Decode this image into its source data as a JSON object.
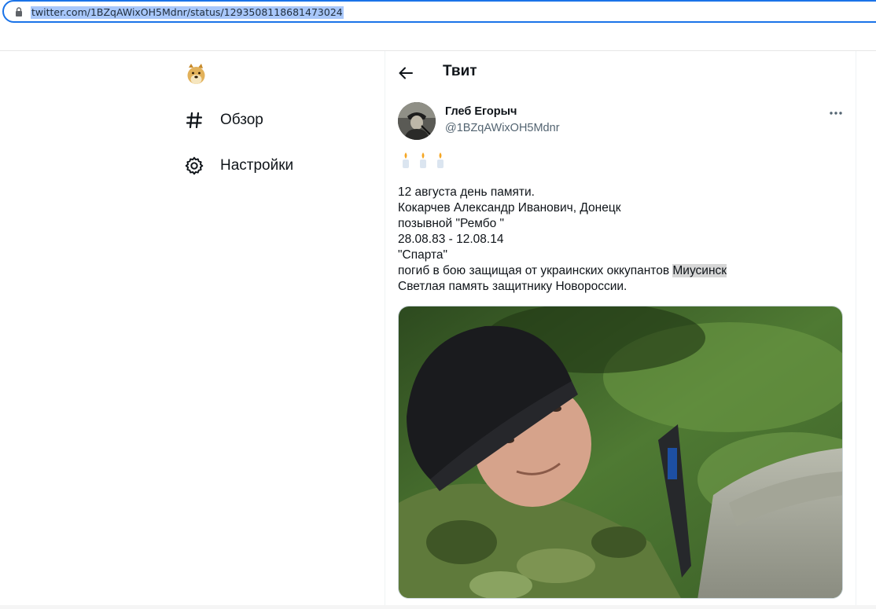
{
  "browser": {
    "url": "twitter.com/1BZqAWixOH5Mdnr/status/1293508118681473024"
  },
  "nav": {
    "items": [
      {
        "icon": "hashtag-icon",
        "label": "Обзор"
      },
      {
        "icon": "gear-icon",
        "label": "Настройки"
      }
    ]
  },
  "header": {
    "title": "Твит"
  },
  "tweet": {
    "author_name": "Глеб Егорыч",
    "author_handle": "@1BZqAWixOH5Mdnr",
    "emoji": "🕯🕯🕯",
    "lines": [
      "12 августа день памяти.",
      "Кокарчев Александр Иванович, Донецк",
      "позывной \"Рембо \"",
      "28.08.83 - 12.08.14",
      "\"Спарта\"",
      "погиб в бою защищая от украинских оккупантов ",
      "Светлая память защитнику Новороссии."
    ],
    "highlighted_word": "Миусинск"
  },
  "colors": {
    "accent_selection": "#a8c7fa",
    "address_border": "#1a73e8",
    "muted_text": "#536471"
  }
}
